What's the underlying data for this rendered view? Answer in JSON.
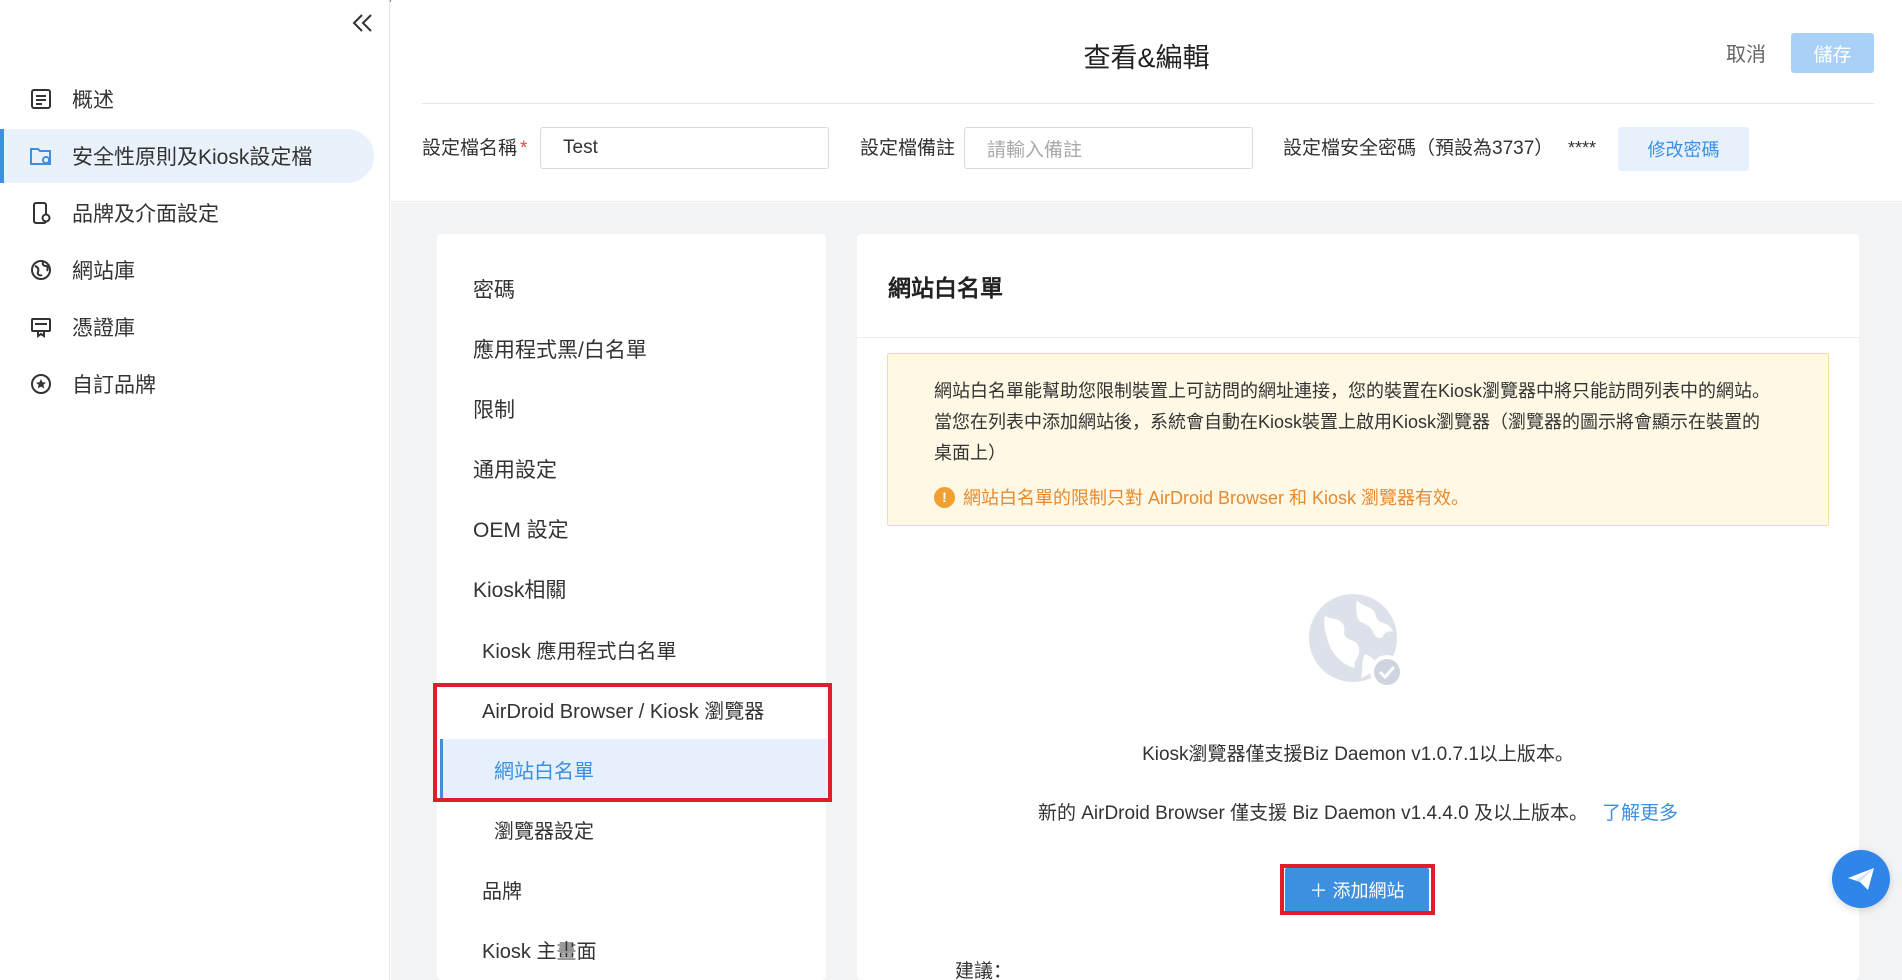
{
  "sidebar": {
    "items": [
      {
        "label": "概述",
        "icon": "document-list-icon"
      },
      {
        "label": "安全性原則及Kiosk設定檔",
        "icon": "folder-settings-icon"
      },
      {
        "label": "品牌及介面設定",
        "icon": "device-settings-icon"
      },
      {
        "label": "網站庫",
        "icon": "globe-icon"
      },
      {
        "label": "憑證庫",
        "icon": "certificate-icon"
      },
      {
        "label": "自訂品牌",
        "icon": "star-circle-icon"
      }
    ]
  },
  "header": {
    "title": "查看&編輯",
    "cancel_label": "取消",
    "save_label": "儲存",
    "profile_name_label": "設定檔名稱",
    "required_mark": "*",
    "profile_name_value": "Test",
    "profile_note_label": "設定檔備註",
    "profile_note_placeholder": "請輸入備註",
    "security_password_label": "設定檔安全密碼（預設為3737）",
    "password_mask": "****",
    "change_password_label": "修改密碼"
  },
  "settings_menu": {
    "password": "密碼",
    "app_list": "應用程式黑/白名單",
    "restrictions": "限制",
    "general": "通用設定",
    "oem": "OEM 設定",
    "kiosk": "Kiosk相關",
    "kiosk_app_whitelist": "Kiosk 應用程式白名單",
    "browser_group": "AirDroid Browser / Kiosk 瀏覽器",
    "website_whitelist": "網站白名單",
    "browser_settings": "瀏覽器設定",
    "brand": "品牌",
    "kiosk_home": "Kiosk 主畫面"
  },
  "main": {
    "title": "網站白名單",
    "notice_line1": "網站白名單能幫助您限制裝置上可訪問的網址連接，您的裝置在Kiosk瀏覽器中將只能訪問列表中的網站。",
    "notice_line2": "當您在列表中添加網站後，系統會自動在Kiosk裝置上啟用Kiosk瀏覽器（瀏覽器的圖示將會顯示在裝置的",
    "notice_line3": "桌面上）",
    "notice_warning": "網站白名單的限制只對 AirDroid Browser 和 Kiosk 瀏覽器有效。",
    "warning_icon_glyph": "!",
    "support_info_1": "Kiosk瀏覽器僅支援Biz Daemon v1.0.7.1以上版本。",
    "support_info_2": "新的 AirDroid Browser 僅支援 Biz Daemon v1.4.4.0 及以上版本。",
    "learn_more": "了解更多",
    "add_site_label": "＋ 添加網站",
    "suggestion_label": "建議："
  },
  "colors": {
    "accent": "#3d8fe0",
    "highlight_box": "#e01e2b",
    "notice_bg": "#fef8e4",
    "warning_text": "#e8892e"
  }
}
